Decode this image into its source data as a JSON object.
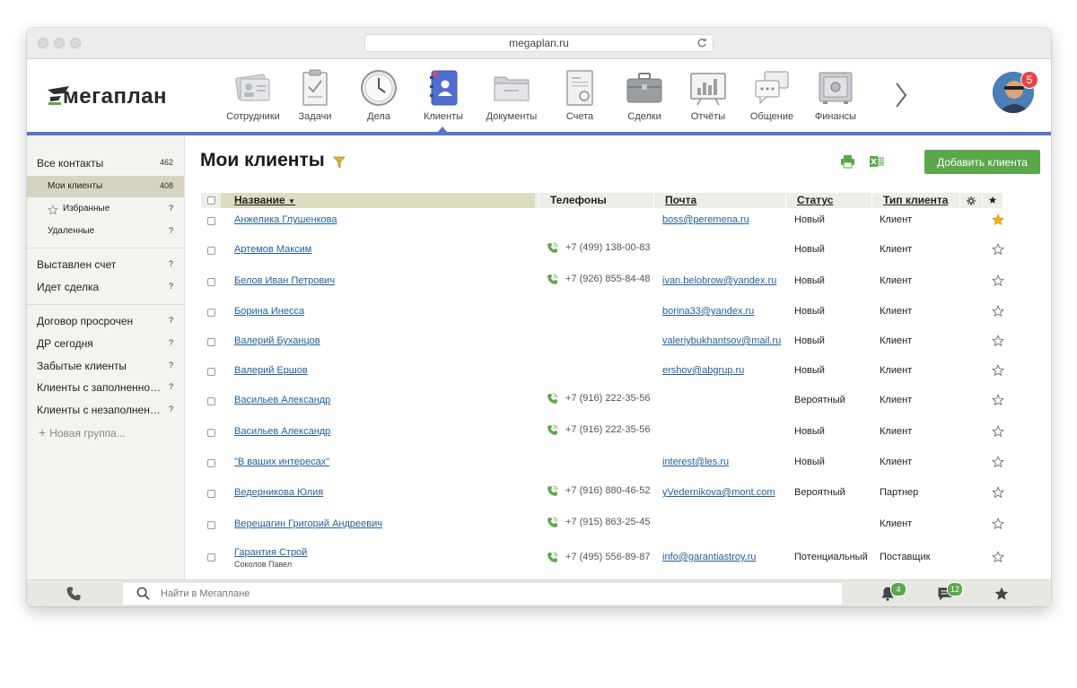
{
  "browser": {
    "url": "megaplan.ru"
  },
  "logo": {
    "text": "мегаплан"
  },
  "nav": {
    "items": [
      {
        "label": "Сотрудники",
        "icon": "employees-icon"
      },
      {
        "label": "Задачи",
        "icon": "tasks-icon"
      },
      {
        "label": "Дела",
        "icon": "clock-icon"
      },
      {
        "label": "Клиенты",
        "icon": "contacts-book-icon"
      },
      {
        "label": "Документы",
        "icon": "folder-icon"
      },
      {
        "label": "Счета",
        "icon": "invoice-icon"
      },
      {
        "label": "Сделки",
        "icon": "briefcase-icon"
      },
      {
        "label": "Отчёты",
        "icon": "report-chart-icon"
      },
      {
        "label": "Общение",
        "icon": "chat-bubbles-icon"
      },
      {
        "label": "Финансы",
        "icon": "safe-icon"
      }
    ],
    "active": "Клиенты",
    "notification_count": "5"
  },
  "sidebar": {
    "items": [
      {
        "label": "Все контакты",
        "count": "462"
      },
      {
        "label": "Мои клиенты",
        "count": "408"
      },
      {
        "label": "Избранные",
        "count": "?"
      },
      {
        "label": "Удаленные",
        "count": "?"
      },
      {
        "label": "Выставлен счет",
        "count": "?"
      },
      {
        "label": "Идет сделка",
        "count": "?"
      },
      {
        "label": "Договор просрочен",
        "count": "?"
      },
      {
        "label": "ДР сегодня",
        "count": "?"
      },
      {
        "label": "Забытые клиенты",
        "count": "?"
      },
      {
        "label": "Клиенты с заполненно…",
        "count": "?"
      },
      {
        "label": "Клиенты с незаполнен…",
        "count": "?"
      }
    ],
    "new_group": "Новая группа..."
  },
  "main": {
    "title": "Мои клиенты",
    "add_button": "Добавить клиента",
    "columns": {
      "name": "Название",
      "phones": "Телефоны",
      "email": "Почта",
      "status": "Статус",
      "type": "Тип клиента"
    },
    "rows": [
      {
        "name": "Анжелика Глушенкова",
        "sub": "",
        "phone": "",
        "email": "boss@peremena.ru",
        "status": "Новый",
        "type": "Клиент",
        "starred": true
      },
      {
        "name": "Артемов Максим",
        "sub": "",
        "phone": "+7 (499) 138-00-83",
        "email": "",
        "status": "Новый",
        "type": "Клиент",
        "starred": false
      },
      {
        "name": "Белов Иван Петрович",
        "sub": "",
        "phone": "+7 (926) 855-84-48",
        "email": "ivan.belobrow@yandex.ru",
        "status": "Новый",
        "type": "Клиент",
        "starred": false
      },
      {
        "name": "Борина Инесса",
        "sub": "",
        "phone": "",
        "email": "borina33@yandex.ru",
        "status": "Новый",
        "type": "Клиент",
        "starred": false
      },
      {
        "name": "Валерий Буханцов",
        "sub": "",
        "phone": "",
        "email": "valeriybukhantsov@mail.ru",
        "status": "Новый",
        "type": "Клиент",
        "starred": false
      },
      {
        "name": "Валерий Ершов",
        "sub": "",
        "phone": "",
        "email": "ershov@abgrup.ru",
        "status": "Новый",
        "type": "Клиент",
        "starred": false
      },
      {
        "name": "Васильев Александр",
        "sub": "",
        "phone": "+7 (916) 222-35-56",
        "email": "",
        "status": "Вероятный",
        "type": "Клиент",
        "starred": false
      },
      {
        "name": "Васильев Александр",
        "sub": "",
        "phone": "+7 (916) 222-35-56",
        "email": "",
        "status": "Новый",
        "type": "Клиент",
        "starred": false
      },
      {
        "name": "\"В ваших интересах\"",
        "sub": "",
        "phone": "",
        "email": "interest@les.ru",
        "status": "Новый",
        "type": "Клиент",
        "starred": false
      },
      {
        "name": "Ведерникова Юлия",
        "sub": "",
        "phone": "+7 (916) 880-46-52",
        "email": "yVedernikova@mont.com",
        "status": "Вероятный",
        "type": "Партнер",
        "starred": false
      },
      {
        "name": "Верещагин Григорий Андреевич",
        "sub": "",
        "phone": "+7 (915) 863-25-45",
        "email": "",
        "status": "",
        "type": "Клиент",
        "starred": false
      },
      {
        "name": "Гарантия Строй",
        "sub": "Соколов Павел",
        "phone": "+7 (495) 556-89-87",
        "email": "info@garantiastroy.ru",
        "status": "Потенциальный",
        "type": "Поставщик",
        "starred": false
      }
    ]
  },
  "bottombar": {
    "search_placeholder": "Найти в Мегаплане",
    "notifications_count": "4",
    "messages_count": "12"
  },
  "colors": {
    "accent_blue": "#5b73c8",
    "add_green": "#5aa84b",
    "star_gold": "#f0b323",
    "link_blue": "#1f5f9c"
  }
}
